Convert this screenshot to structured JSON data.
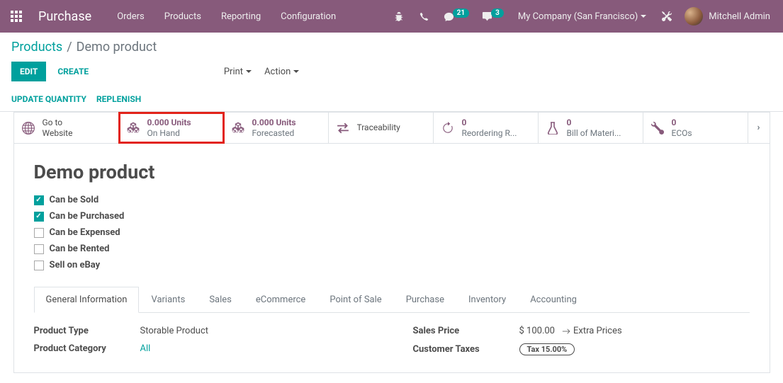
{
  "navbar": {
    "brand": "Purchase",
    "menu": [
      "Orders",
      "Products",
      "Reporting",
      "Configuration"
    ],
    "messaging_badge": "21",
    "activities_badge": "3",
    "company": "My Company (San Francisco)",
    "user": "Mitchell Admin"
  },
  "breadcrumb": {
    "root": "Products",
    "current": "Demo product"
  },
  "cp": {
    "edit": "EDIT",
    "create": "CREATE",
    "print": "Print",
    "action": "Action",
    "update_qty": "UPDATE QUANTITY",
    "replenish": "REPLENISH"
  },
  "stats": {
    "website": {
      "l1": "Go to",
      "l2": "Website"
    },
    "onhand": {
      "value": "0.000 Units",
      "label": "On Hand"
    },
    "forecast": {
      "value": "0.000 Units",
      "label": "Forecasted"
    },
    "trace": {
      "label": "Traceability"
    },
    "reorder": {
      "value": "0",
      "label": "Reordering R..."
    },
    "bom": {
      "value": "0",
      "label": "Bill of Materi..."
    },
    "eco": {
      "value": "0",
      "label": "ECOs"
    }
  },
  "product": {
    "name": "Demo product"
  },
  "checks": {
    "sold": "Can be Sold",
    "purchased": "Can be Purchased",
    "expensed": "Can be Expensed",
    "rented": "Can be Rented",
    "ebay": "Sell on eBay"
  },
  "tabs": [
    "General Information",
    "Variants",
    "Sales",
    "eCommerce",
    "Point of Sale",
    "Purchase",
    "Inventory",
    "Accounting"
  ],
  "fields": {
    "product_type": {
      "label": "Product Type",
      "value": "Storable Product"
    },
    "product_category": {
      "label": "Product Category",
      "value": "All"
    },
    "sales_price": {
      "label": "Sales Price",
      "value": "$ 100.00",
      "extra": "Extra Prices"
    },
    "customer_taxes": {
      "label": "Customer Taxes",
      "value": "Tax 15.00%"
    }
  }
}
